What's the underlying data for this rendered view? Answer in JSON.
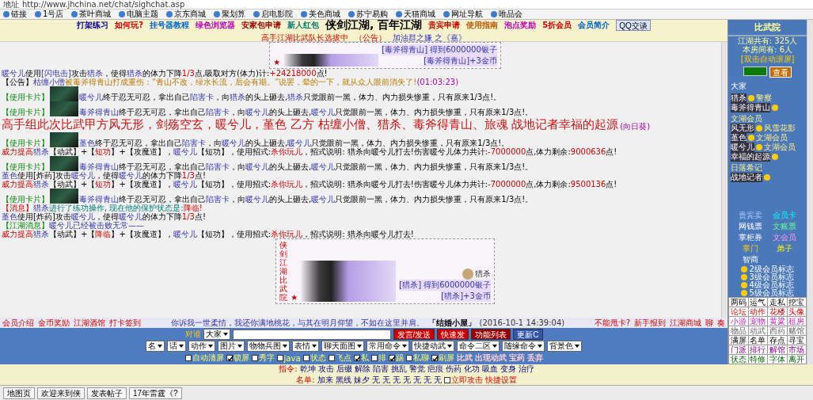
{
  "address_bar": {
    "label": "地址",
    "url": "http://www.jhchina.net/chat/sighchat.asp"
  },
  "favorites": [
    "链接",
    "1号店",
    "茶叶商城",
    "电脑主题",
    "京东商城",
    "聚划算",
    "启电影院",
    "美色商城",
    "苏宁易购",
    "天猫商城",
    "网址导航",
    "唯品会"
  ],
  "header": {
    "links_left": [
      "打架练习",
      "如何玩?",
      "挂号器教程",
      "绿色浏览器",
      "安家包申请",
      "新人红包"
    ],
    "title": "侠剑江湖, 百年江湖",
    "links_right": [
      "贵宾申请",
      "使用指南",
      "泡点奖励",
      "5折会员",
      "会员简介"
    ],
    "qq": "QQ交谈",
    "notice": [
      "高手江湖比武队长选拔中",
      "（公告）",
      "加油群之嫌 之《嘉》"
    ]
  },
  "messages": [
    {
      "kind": "figure",
      "star": "★",
      "lines": [
        "[毒斧得青山] 得到6000000银子",
        "[毒斧得青山]+3金币"
      ]
    },
    {
      "kind": "text",
      "parts": [
        {
          "kind": "name",
          "text": "暖兮儿"
        },
        {
          "kind": "plain",
          "text": "使用"
        },
        {
          "kind": "name",
          "text": "[闪电击]"
        },
        {
          "kind": "plain",
          "text": "攻击"
        },
        {
          "kind": "name",
          "text": "猎杀"
        },
        {
          "kind": "plain",
          "text": "，使得"
        },
        {
          "kind": "name",
          "text": "猎杀"
        },
        {
          "kind": "plain",
          "text": "的体力下降"
        },
        {
          "kind": "red",
          "text": "1/3"
        },
        {
          "kind": "plain",
          "text": "点,吸取对方(体力)计:"
        },
        {
          "kind": "red",
          "text": "+24218000"
        },
        {
          "kind": "plain",
          "text": "点!"
        }
      ]
    },
    {
      "kind": "text",
      "parts": [
        {
          "kind": "plain",
          "text": "【公告】"
        },
        {
          "kind": "name",
          "text": "枯缠小僧"
        },
        {
          "kind": "quote",
          "text": "被毒斧得青山打成重伤：“青山不改，绿水长流，后会有期。”说罢，晕的一下，就从众人眼前消失了!"
        },
        {
          "kind": "time",
          "text": "(01:03:23)"
        }
      ]
    },
    {
      "kind": "card",
      "label": "【使用卡片】",
      "parts": [
        {
          "kind": "name",
          "text": "暖兮儿"
        },
        {
          "kind": "plain",
          "text": "终于忍无可忍，拿出自己"
        },
        {
          "kind": "name",
          "text": "陷害卡"
        },
        {
          "kind": "plain",
          "text": "，向"
        },
        {
          "kind": "name",
          "text": "猎杀"
        },
        {
          "kind": "plain",
          "text": "的头上砸去,"
        },
        {
          "kind": "name",
          "text": "猎杀"
        },
        {
          "kind": "plain",
          "text": "只觉眼前一黑，体力、内力损失惨重，只有原来1/3点!。"
        }
      ]
    },
    {
      "kind": "card",
      "label": "【使用卡片】",
      "parts": [
        {
          "kind": "name",
          "text": "毒斧得青山"
        },
        {
          "kind": "plain",
          "text": "终于忍无可忍，拿出自己"
        },
        {
          "kind": "name",
          "text": "陷害卡"
        },
        {
          "kind": "plain",
          "text": "，向"
        },
        {
          "kind": "name",
          "text": "暖兮儿"
        },
        {
          "kind": "plain",
          "text": "的头上砸去,"
        },
        {
          "kind": "name",
          "text": "暖兮儿"
        },
        {
          "kind": "plain",
          "text": "只觉眼前一黑，体力、内力损失惨重，只有原来1/3点!。"
        }
      ]
    },
    {
      "kind": "banner",
      "text": "高手组此次比武甲方风无形，剑殇空玄，暖兮儿，堇色 乙方 枯缠小僧、猎杀、毒斧得青山、旅魂 战地记者幸福的起源",
      "suffix": "(向日葵)"
    },
    {
      "kind": "card",
      "label": "【使用卡片】",
      "parts": [
        {
          "kind": "name",
          "text": "堇色"
        },
        {
          "kind": "plain",
          "text": "终于忍无可忍，拿出自己"
        },
        {
          "kind": "name",
          "text": "陷害卡"
        },
        {
          "kind": "plain",
          "text": "，向"
        },
        {
          "kind": "name",
          "text": "暖兮儿"
        },
        {
          "kind": "plain",
          "text": "的头上砸去,"
        },
        {
          "kind": "name",
          "text": "暖兮儿"
        },
        {
          "kind": "plain",
          "text": "只觉眼前一黑，体力、内力损失惨重，只有原来1/3点!。"
        }
      ]
    },
    {
      "kind": "text",
      "parts": [
        {
          "kind": "red",
          "text": "威力提高"
        },
        {
          "kind": "name",
          "text": "猎杀"
        },
        {
          "kind": "plain",
          "text": "【动武】+【"
        },
        {
          "kind": "red",
          "text": "短功"
        },
        {
          "kind": "plain",
          "text": "】+【攻魔道】，"
        },
        {
          "kind": "name",
          "text": "暖兮儿"
        },
        {
          "kind": "plain",
          "text": "【短功】，使用招式:"
        },
        {
          "kind": "red",
          "text": "杀你玩儿"
        },
        {
          "kind": "plain",
          "text": "，招式说明: 猎杀向暖兮儿打去!伤害暖兮儿体力共计:"
        },
        {
          "kind": "red",
          "text": "-7000000"
        },
        {
          "kind": "plain",
          "text": "点,体力剩余:"
        },
        {
          "kind": "red",
          "text": "9000636"
        },
        {
          "kind": "plain",
          "text": "点!"
        }
      ]
    },
    {
      "kind": "card",
      "label": "【使用卡片】",
      "parts": [
        {
          "kind": "name",
          "text": "毒斧得青山"
        },
        {
          "kind": "plain",
          "text": "终于忍无可忍，拿出自己"
        },
        {
          "kind": "name",
          "text": "陷害卡"
        },
        {
          "kind": "plain",
          "text": "，向"
        },
        {
          "kind": "name",
          "text": "暖兮儿"
        },
        {
          "kind": "plain",
          "text": "的头上砸去,"
        },
        {
          "kind": "name",
          "text": "暖兮儿"
        },
        {
          "kind": "plain",
          "text": "只觉眼前一黑，体力、内力损失惨重，只有原来1/3点!。"
        }
      ]
    },
    {
      "kind": "text",
      "parts": [
        {
          "kind": "name",
          "text": "堇色"
        },
        {
          "kind": "plain",
          "text": "使用[炸药]攻击"
        },
        {
          "kind": "name",
          "text": "暖兮儿"
        },
        {
          "kind": "plain",
          "text": "，使得"
        },
        {
          "kind": "name",
          "text": "暖兮儿"
        },
        {
          "kind": "plain",
          "text": "的体力下降"
        },
        {
          "kind": "red",
          "text": "1/3"
        },
        {
          "kind": "plain",
          "text": "点!"
        }
      ]
    },
    {
      "kind": "text",
      "parts": [
        {
          "kind": "red",
          "text": "威力提高"
        },
        {
          "kind": "name",
          "text": "猎杀"
        },
        {
          "kind": "plain",
          "text": "【动武】+【"
        },
        {
          "kind": "red",
          "text": "短功"
        },
        {
          "kind": "plain",
          "text": "】+【攻魔道】，"
        },
        {
          "kind": "name",
          "text": "暖兮儿"
        },
        {
          "kind": "plain",
          "text": "【短功】，使用招式:"
        },
        {
          "kind": "red",
          "text": "杀你玩儿"
        },
        {
          "kind": "plain",
          "text": "，招式说明: 猎杀向暖兮儿打去!伤害暖兮儿体力共计:"
        },
        {
          "kind": "red",
          "text": "-7000000"
        },
        {
          "kind": "plain",
          "text": "点,体力剩余:"
        },
        {
          "kind": "red",
          "text": "9500136"
        },
        {
          "kind": "plain",
          "text": "点!"
        }
      ]
    },
    {
      "kind": "card",
      "label": "【使用卡片】",
      "parts": [
        {
          "kind": "name",
          "text": "毒斧得青山"
        },
        {
          "kind": "plain",
          "text": "终于忍无可忍，拿出自己"
        },
        {
          "kind": "name",
          "text": "陷害卡"
        },
        {
          "kind": "plain",
          "text": "，向"
        },
        {
          "kind": "name",
          "text": "暖兮儿"
        },
        {
          "kind": "plain",
          "text": "的头上砸去,"
        },
        {
          "kind": "name",
          "text": "暖兮儿"
        },
        {
          "kind": "plain",
          "text": "只觉眼前一黑，体力、内力损失惨重，只有原来1/3点!。"
        }
      ]
    },
    {
      "kind": "text",
      "parts": [
        {
          "kind": "red",
          "text": "【消息】"
        },
        {
          "kind": "name",
          "text": "猎杀"
        },
        {
          "kind": "info",
          "text": "进行了练功操作, 现在他的保护状态是:"
        },
        {
          "kind": "red",
          "text": "降临!"
        }
      ]
    },
    {
      "kind": "text",
      "parts": [
        {
          "kind": "name",
          "text": "堇色"
        },
        {
          "kind": "plain",
          "text": "使用[炸药]攻击"
        },
        {
          "kind": "name",
          "text": "暖兮儿"
        },
        {
          "kind": "plain",
          "text": "，使得"
        },
        {
          "kind": "name",
          "text": "暖兮儿"
        },
        {
          "kind": "plain",
          "text": "的体力下降"
        },
        {
          "kind": "red",
          "text": "1/3"
        },
        {
          "kind": "plain",
          "text": "点!"
        }
      ]
    },
    {
      "kind": "text",
      "parts": [
        {
          "kind": "green",
          "text": "【江湖消息】"
        },
        {
          "kind": "name",
          "text": "暖兮儿已经被击败无常——"
        }
      ]
    },
    {
      "kind": "text",
      "parts": [
        {
          "kind": "red",
          "text": "威力提高"
        },
        {
          "kind": "name",
          "text": "猎杀"
        },
        {
          "kind": "plain",
          "text": "【动武】+【"
        },
        {
          "kind": "red",
          "text": "降临"
        },
        {
          "kind": "plain",
          "text": "】+【攻魔道】，"
        },
        {
          "kind": "name",
          "text": "暖兮儿"
        },
        {
          "kind": "plain",
          "text": "【短功】，使用招式:"
        },
        {
          "kind": "red",
          "text": "杀你玩儿"
        },
        {
          "kind": "plain",
          "text": "，招式说明: 猎杀向暖兮儿打去!"
        }
      ]
    },
    {
      "kind": "figure",
      "side": "侠剑江湖比武院",
      "star": "★",
      "avatar_name": "猎杀",
      "lines": [
        "[猎杀] 得到6000000银子",
        "[猎杀]+3金币"
      ]
    }
  ],
  "room_panel": {
    "title": "比武院",
    "stats": [
      "江湖共有: 325人",
      "本房间有: 6人"
    ],
    "scroll_toggle": "[双击自动滚屏]",
    "view_button": "查看",
    "everyone": "大家",
    "users": [
      {
        "name": "猎杀",
        "tag": "警察"
      },
      {
        "name": "毒斧得青山",
        "tag": "文湖会员"
      },
      {
        "name": "风无形",
        "tag": "风雪花影"
      },
      {
        "name": "堇色",
        "tag": "文湖会员"
      },
      {
        "name": "暖兮儿",
        "tag": "文湖会员"
      },
      {
        "name": "幸福的起源",
        "tag": "日落希记"
      },
      {
        "name": "战地记者"
      }
    ],
    "links": [
      "贵宾卖",
      "会员卡",
      "网钱票",
      "文账票",
      "掌柜券",
      "文会员",
      "掌门",
      "弟子",
      "智商"
    ],
    "badges": [
      "2级会员标志",
      "3级会员标志",
      "4级会员标志",
      "5级会员标志"
    ],
    "commands": [
      "两码",
      "运气",
      "走私",
      "挖宝",
      "论坛",
      "动作",
      "花楼",
      "头像",
      "小游",
      "宠物",
      "黄粱",
      "租房",
      "物品",
      "动武",
      "西药",
      "赌馆",
      "满屏",
      "名单",
      "存点",
      "寻宝",
      "门派",
      "排行",
      "解馆",
      "市场",
      "状态",
      "特修",
      "字体",
      "离开"
    ]
  },
  "links_bar": {
    "left": [
      "会员介绍",
      "金币奖励",
      "江湖酒馆",
      "打卡签到"
    ],
    "message": "你诉我一世柔情，我还你满地桃花，与其在明月仰望，不如在这里并肩。",
    "place": "「结婚小屋」",
    "time": "(2016-10-1 14:39:04)",
    "right": [
      "不能甩卡?",
      "新手报到",
      "江湖商城",
      "聊",
      "奏"
    ]
  },
  "input_area": {
    "to_label": "对谁",
    "to_value": "大家",
    "buttons": [
      "发言/发送",
      "快速发",
      "功能列表",
      "更新C"
    ],
    "selects": [
      "名",
      "话",
      "动作",
      "图片",
      "物物兵图",
      "表情",
      "聊天面图",
      "常用命令",
      "快捷动武",
      "命令二区",
      "随缘命令",
      "背景色"
    ],
    "options": [
      {
        "label": "自动清屏",
        "checked": false
      },
      {
        "label": "锁屏",
        "checked": true
      },
      {
        "label": "秀字",
        "checked": false
      },
      {
        "label": "java",
        "checked": false
      },
      {
        "label": "状态",
        "checked": false
      },
      {
        "label": "飞点",
        "checked": false
      },
      {
        "label": "私",
        "checked": true
      },
      {
        "label": "排",
        "checked": false
      },
      {
        "label": "踢",
        "checked": true
      },
      {
        "label": "私聊",
        "checked": false
      },
      {
        "label": "刷屏",
        "checked": true
      }
    ],
    "extra_links": [
      "比武",
      "出现动武",
      "宝药",
      "丢弃"
    ]
  },
  "commands": {
    "label": "指令:",
    "items": [
      "乾坤",
      "攻击",
      "后缀",
      "解除",
      "陷害",
      "挑乱",
      "警觉",
      "疤痕",
      "伤药",
      "化功",
      "吸血",
      "变身",
      "治疗"
    ],
    "list_label": "名单:",
    "list": [
      "加来",
      "黑线",
      "妹夕",
      "无",
      "无",
      "无",
      "无",
      "无",
      "无",
      "无"
    ],
    "attack_now": {
      "label": "立即攻击",
      "checked": false
    },
    "settings": "快捷设置"
  },
  "taskbar": [
    "地图页",
    "欢迎来到侠",
    "发表帖子",
    "17年雷霆《?"
  ]
}
